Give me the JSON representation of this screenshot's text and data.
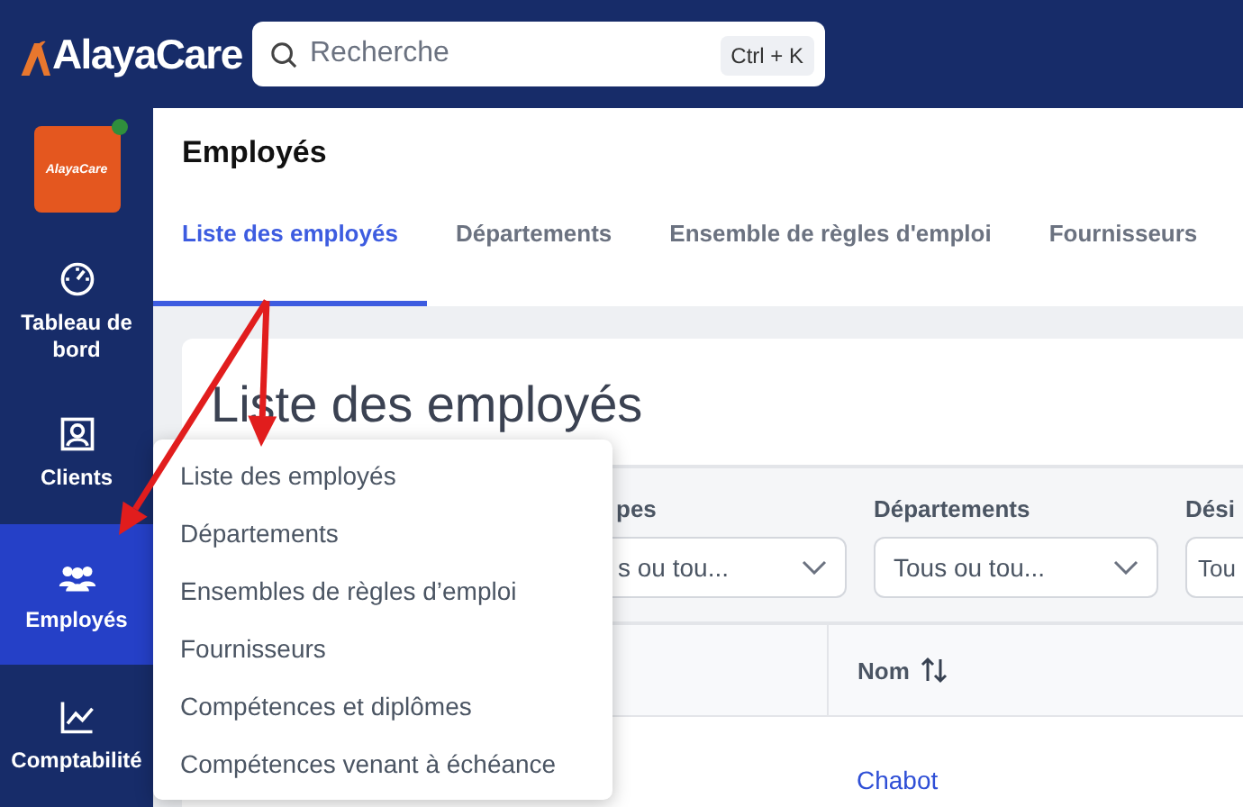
{
  "topbar": {
    "logo": "AlayaCare",
    "search": {
      "placeholder": "Recherche",
      "shortcut": "Ctrl + K"
    }
  },
  "sidebar": {
    "org_tile": {
      "label": "AlayaCare",
      "online": true
    },
    "items": [
      {
        "label": "Tableau de bord",
        "kind": "gauge",
        "selected": false
      },
      {
        "label": "Clients",
        "kind": "contact",
        "selected": false
      },
      {
        "label": "Employés",
        "kind": "people",
        "selected": true
      },
      {
        "label": "Comptabilité",
        "kind": "chart",
        "selected": false
      }
    ]
  },
  "page": {
    "title": "Employés",
    "tabs": [
      {
        "label": "Liste des employés",
        "selected": true
      },
      {
        "label": "Départements",
        "selected": false
      },
      {
        "label": "Ensemble de règles d'emploi",
        "selected": false
      },
      {
        "label": "Fournisseurs",
        "selected": false
      }
    ]
  },
  "card": {
    "title": "Liste des employés",
    "filters": [
      {
        "label": "pes",
        "value": "s ou tou..."
      },
      {
        "label": "Départements",
        "value": "Tous ou tou..."
      },
      {
        "label": "Dési",
        "value": "Tou"
      }
    ],
    "table": {
      "columns": [
        "",
        "Nom"
      ],
      "rows": [
        [
          "",
          "Chabot"
        ]
      ]
    }
  },
  "menu": {
    "items": [
      "Liste des employés",
      "Départements",
      "Ensembles de règles d’emploi",
      "Fournisseurs",
      "Compétences et diplômes",
      "Compétences venant à échéance"
    ]
  },
  "annotations": [
    {
      "kind": "arrow"
    },
    {
      "kind": "arrow"
    }
  ]
}
